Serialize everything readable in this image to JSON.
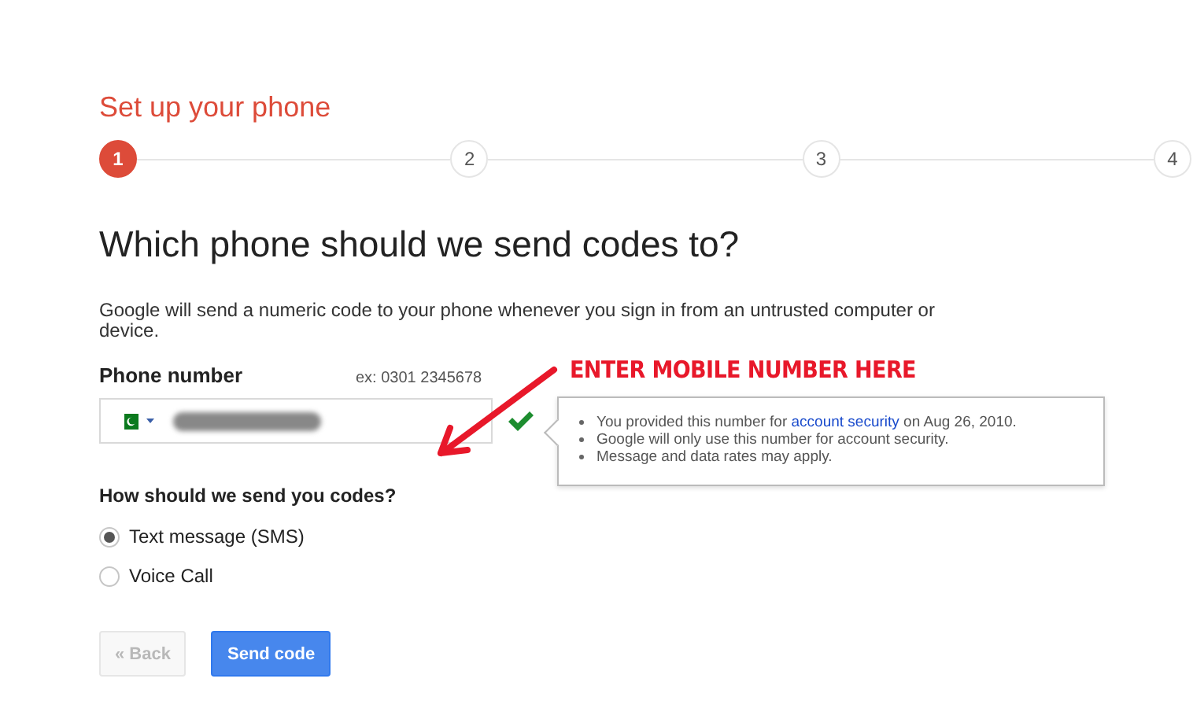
{
  "title": "Set up your phone",
  "steps": [
    {
      "label": "1",
      "selected": true
    },
    {
      "label": "2",
      "selected": false
    },
    {
      "label": "3",
      "selected": false
    },
    {
      "label": "4",
      "selected": false
    }
  ],
  "heading": "Which phone should we send codes to?",
  "description": "Google will send a numeric code to your phone whenever you sign in from an untrusted computer or device.",
  "phone": {
    "label": "Phone number",
    "example": "ex: 0301 2345678",
    "valid": true
  },
  "tips": [
    {
      "text": "You provided this number for ",
      "link": "account security",
      "text_after": " on Aug 26, 2010."
    },
    {
      "text": "Google will only use this number for account security."
    },
    {
      "text": "Message and data rates may apply."
    }
  ],
  "method": {
    "question": "How should we send you codes?",
    "options": [
      {
        "label": "Text message (SMS)",
        "selected": true
      },
      {
        "label": "Voice Call",
        "selected": false
      }
    ]
  },
  "buttons": [
    {
      "label": "« Back",
      "kind": "secondary",
      "disabled": true
    },
    {
      "label": "Send code",
      "kind": "primary",
      "disabled": false
    }
  ],
  "annotation": {
    "text": "ENTER MOBILE NUMBER HERE"
  }
}
